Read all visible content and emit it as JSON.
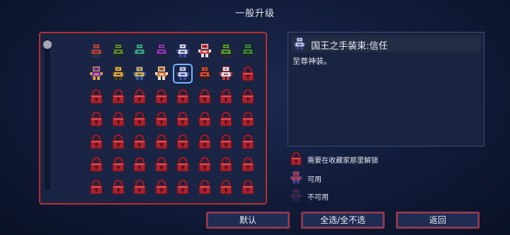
{
  "title": "一般升级",
  "info": {
    "name": "国王之手装束:信任",
    "description": "至尊神装。",
    "icon": "knight-outfit-icon"
  },
  "legend": [
    {
      "icon": "red-lock-icon",
      "text": "需要在收藏家那里解锁"
    },
    {
      "icon": "outfit-icon",
      "text": "可用"
    },
    {
      "icon": "outfit-dim-icon",
      "text": "不可用"
    }
  ],
  "buttons": {
    "default": "默认",
    "select_all": "全选/全不选",
    "back": "返回"
  },
  "grid": {
    "columns": 8,
    "rows": 7,
    "items": [
      {
        "type": "outfit",
        "color": "#c43a3a",
        "accent": "#2a3a3a"
      },
      {
        "type": "outfit",
        "color": "#5e8a3a",
        "accent": "#1c2618"
      },
      {
        "type": "outfit",
        "color": "#3aa58a",
        "accent": "#20303a"
      },
      {
        "type": "outfit",
        "color": "#8a3ab4",
        "accent": "#2a1a3a"
      },
      {
        "type": "outfit",
        "color": "#d8d8e0",
        "accent": "#3a4aa0"
      },
      {
        "type": "outfit",
        "color": "#d83a3a",
        "accent": "#e0e0e0"
      },
      {
        "type": "outfit",
        "color": "#4aa03a",
        "accent": "#3a2a1a"
      },
      {
        "type": "outfit",
        "color": "#3a8a3a",
        "accent": "#1a2a1a"
      },
      {
        "type": "outfit",
        "color": "#8a3ab4",
        "accent": "#d8a03a"
      },
      {
        "type": "outfit",
        "color": "#d8b04a",
        "accent": "#5a3a1a"
      },
      {
        "type": "outfit",
        "color": "#d8b04a",
        "accent": "#3a5aa0"
      },
      {
        "type": "outfit",
        "color": "#d87a3a",
        "accent": "#e8e0d0"
      },
      {
        "type": "outfit",
        "color": "#c8d0e0",
        "accent": "#3a4aa0",
        "selected": true
      },
      {
        "type": "outfit",
        "color": "#d84a2a",
        "accent": "#3a1a1a"
      },
      {
        "type": "outfit",
        "color": "#e0e4ea",
        "accent": "#c83a3a"
      },
      {
        "type": "lock"
      }
    ],
    "lock_fill": "#a8232f",
    "lock_dark": "#5a0e18"
  }
}
